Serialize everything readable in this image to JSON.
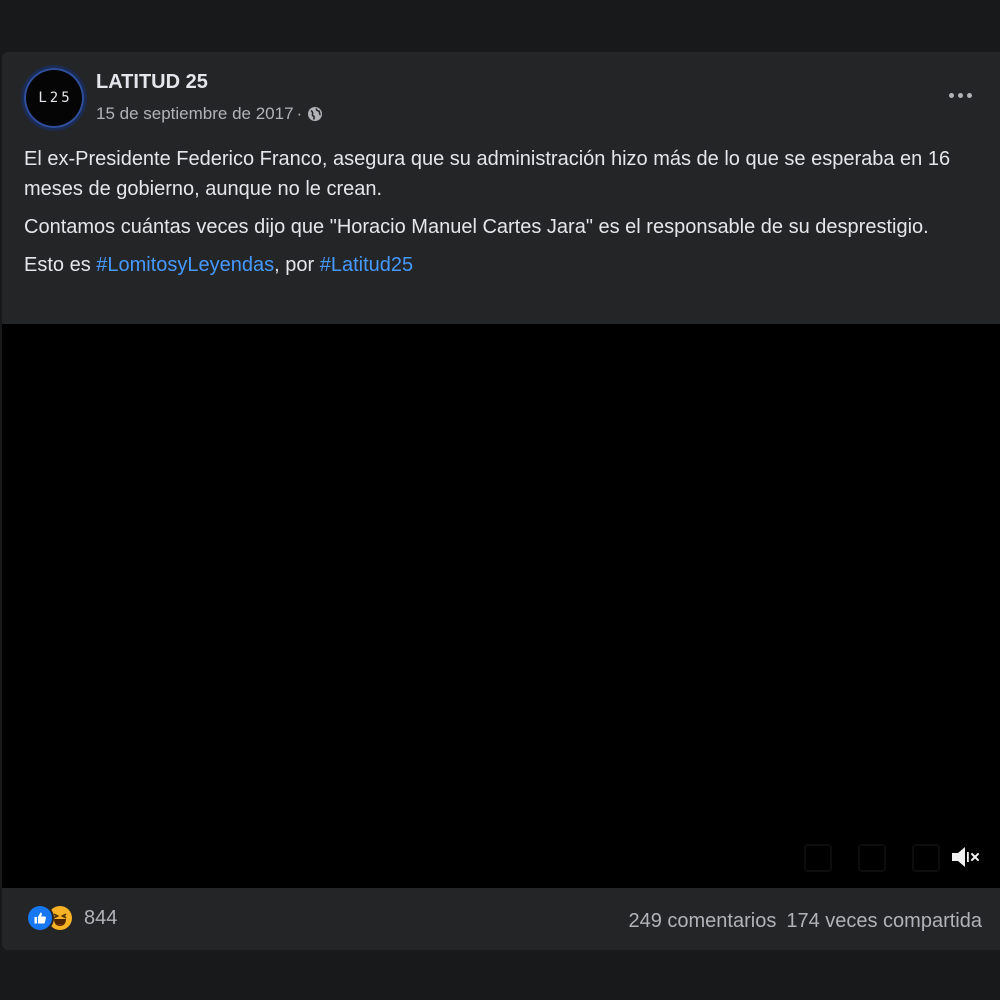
{
  "post": {
    "page_name": "LATITUD 25",
    "avatar_text": "L25",
    "date": "15 de septiembre de 2017",
    "separator": "·",
    "privacy_icon": "globe-icon",
    "more_icon": "more-horizontal-icon",
    "paragraph1": "El ex-Presidente Federico Franco, asegura que su administración hizo más de lo que se esperaba en 16 meses de gobierno, aunque no le crean.",
    "paragraph2": "Contamos cuántas veces dijo que \"Horacio Manuel Cartes Jara\" es el responsable de su desprestigio.",
    "paragraph3_prefix": "Esto es ",
    "hashtag1": "#LomitosyLeyendas",
    "paragraph3_middle": ", por ",
    "hashtag2": "#Latitud25"
  },
  "video": {
    "mute_icon": "muted-speaker-icon"
  },
  "footer": {
    "reaction_icons": [
      "like-icon",
      "haha-icon"
    ],
    "reaction_count": "844",
    "comments": "249 comentarios",
    "shares": "174 veces compartida"
  },
  "colors": {
    "background": "#18191a",
    "card": "#242526",
    "text_primary": "#e4e6eb",
    "text_secondary": "#b0b3b8",
    "hashtag": "#4599ff",
    "like_blue": "#1877f2",
    "haha_yellow": "#f7b125"
  }
}
